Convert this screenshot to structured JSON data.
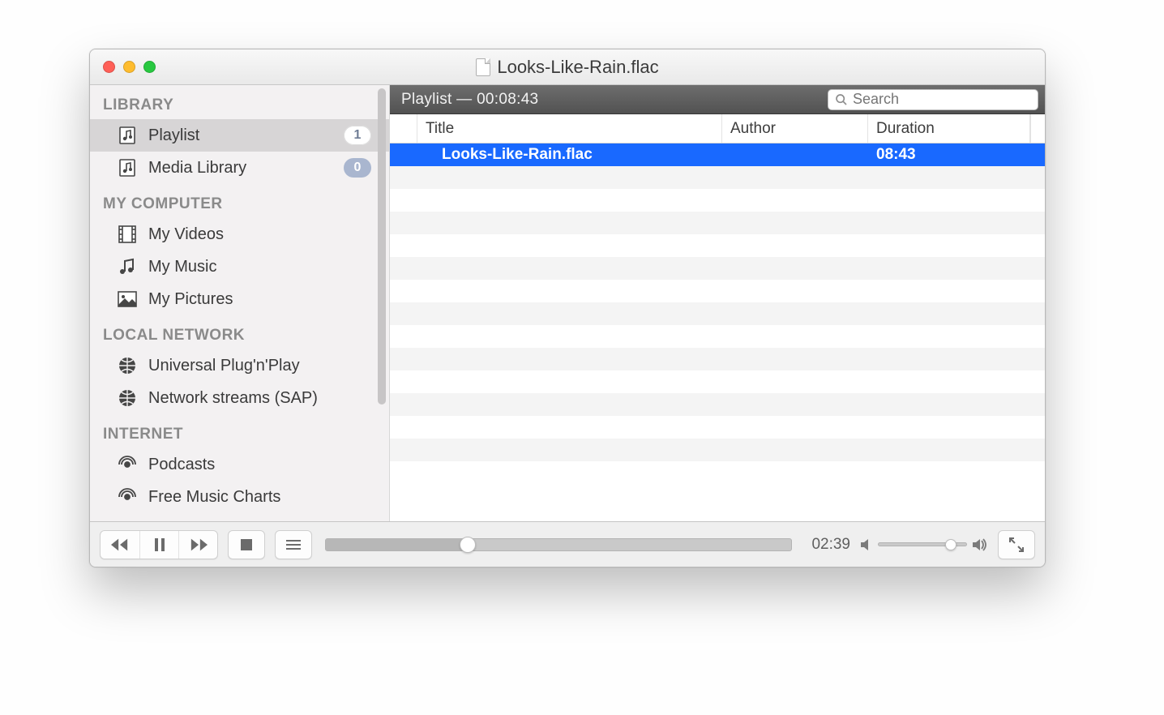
{
  "window": {
    "title": "Looks-Like-Rain.flac"
  },
  "sidebar": {
    "sections": [
      {
        "heading": "LIBRARY",
        "items": [
          {
            "label": "Playlist",
            "icon": "playlist-icon",
            "badge": "1",
            "badge_style": "white",
            "selected": true
          },
          {
            "label": "Media Library",
            "icon": "media-library-icon",
            "badge": "0",
            "badge_style": "blue"
          }
        ]
      },
      {
        "heading": "MY COMPUTER",
        "items": [
          {
            "label": "My Videos",
            "icon": "film-icon"
          },
          {
            "label": "My Music",
            "icon": "music-note-icon"
          },
          {
            "label": "My Pictures",
            "icon": "picture-icon"
          }
        ]
      },
      {
        "heading": "LOCAL NETWORK",
        "items": [
          {
            "label": "Universal Plug'n'Play",
            "icon": "globe-icon"
          },
          {
            "label": "Network streams (SAP)",
            "icon": "globe-icon"
          }
        ]
      },
      {
        "heading": "INTERNET",
        "items": [
          {
            "label": "Podcasts",
            "icon": "podcast-icon"
          },
          {
            "label": "Free Music Charts",
            "icon": "podcast-icon"
          }
        ]
      }
    ]
  },
  "playlist": {
    "header_label": "Playlist",
    "header_sep": " — ",
    "total_duration": "00:08:43",
    "search_placeholder": "Search",
    "columns": {
      "title": "Title",
      "author": "Author",
      "duration": "Duration"
    },
    "rows": [
      {
        "title": "Looks-Like-Rain.flac",
        "author": "",
        "duration": "08:43",
        "selected": true
      }
    ]
  },
  "player": {
    "elapsed": "02:39",
    "progress_percent": 30.5,
    "volume_percent": 82
  }
}
